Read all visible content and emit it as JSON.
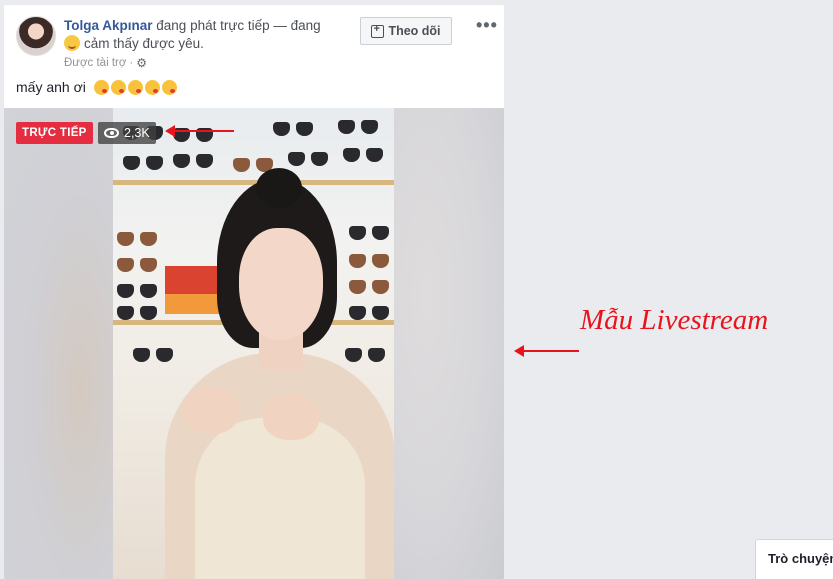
{
  "post": {
    "author": "Tolga Akpınar",
    "status_text": "đang phát trực tiếp — đang",
    "feeling_text": "cảm thấy được yêu.",
    "sponsored": "Được tài trợ",
    "separator": "·",
    "follow_label": "Theo dõi",
    "more_label": "•••",
    "caption": "mấy anh ơi",
    "caption_emoji_count": 5
  },
  "video": {
    "live_label": "TRỰC TIẾP",
    "viewer_count": "2,3K"
  },
  "annotation": {
    "text": "Mẫu Livestream"
  },
  "chat": {
    "label": "Trò chuyện"
  },
  "colors": {
    "live_badge": "#e42d40",
    "author_link": "#365899",
    "annotation_red": "#e8141d",
    "page_bg": "#e9ebee"
  },
  "icons": {
    "avatar": "user-avatar",
    "feeling": "smiling-face-icon",
    "settings": "gear-icon",
    "follow": "follow-plus-icon",
    "more": "more-dots-icon",
    "viewers": "eye-icon",
    "caption_emoji": "kissing-face-emoji"
  }
}
